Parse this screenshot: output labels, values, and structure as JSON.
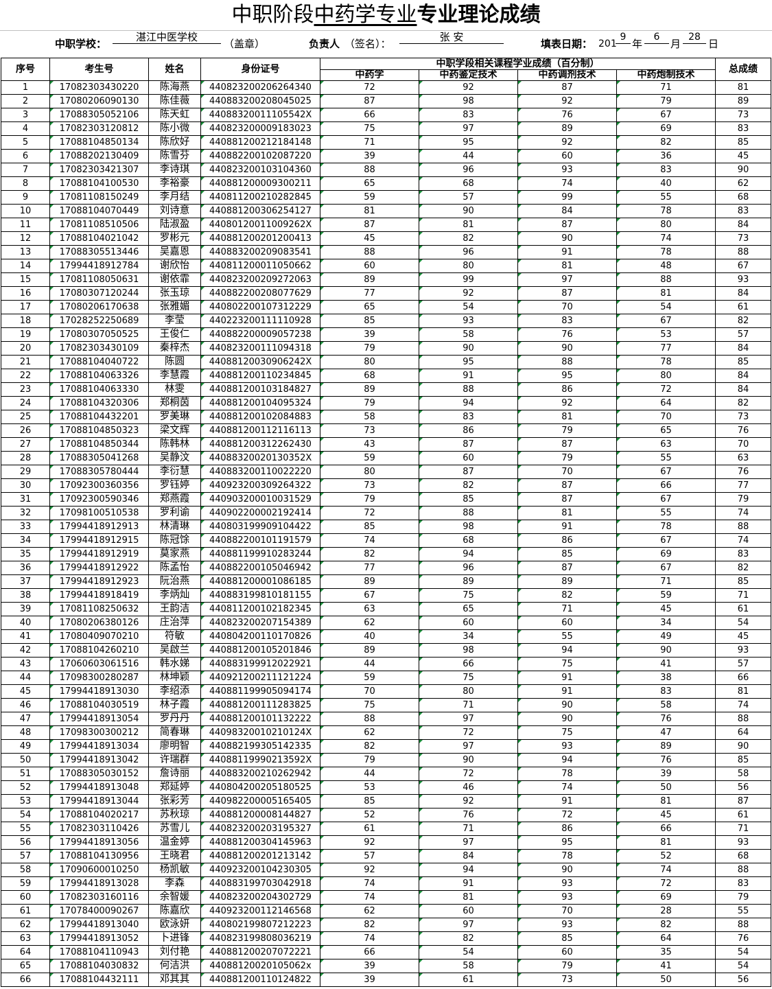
{
  "title": {
    "part1": "中职阶段",
    "part2": "中药学专业",
    "part3": "专业理论成绩"
  },
  "meta": {
    "school_label": "中职学校：",
    "school_value": "湛江中医学校",
    "seal": "（盖章）",
    "person_label": "负责人",
    "person_hint": "（签名）：",
    "person_value": "张  安",
    "date_label": "填表日期：",
    "year_prefix": "201",
    "year_digit": "9",
    "year_unit": "年",
    "month": "6",
    "month_unit": "月",
    "day": "28",
    "day_unit": "日"
  },
  "table": {
    "headers": {
      "seq": "序号",
      "exam_no": "考生号",
      "name": "姓名",
      "id": "身份证号",
      "group": "中职学段相关课程学业成绩（百分制）",
      "c1": "中药学",
      "c2": "中药鉴定技术",
      "c3": "中药调剂技术",
      "c4": "中药炮制技术",
      "total": "总成绩"
    },
    "rows": [
      [
        "1",
        "17082303430220",
        "陈海燕",
        "440823200206264340",
        "72",
        "92",
        "87",
        "71",
        "81"
      ],
      [
        "2",
        "17080206090130",
        "陈佳薇",
        "440883200208045025",
        "87",
        "98",
        "92",
        "79",
        "89"
      ],
      [
        "3",
        "17088305052106",
        "陈天虹",
        "44088320011105542X",
        "66",
        "83",
        "76",
        "67",
        "73"
      ],
      [
        "4",
        "17082303120812",
        "陈小微",
        "440823200009183023",
        "75",
        "97",
        "89",
        "69",
        "83"
      ],
      [
        "5",
        "17088104850134",
        "陈欣好",
        "440881200212184148",
        "71",
        "95",
        "92",
        "82",
        "85"
      ],
      [
        "6",
        "17088202130409",
        "陈雪芬",
        "440882200102087220",
        "39",
        "44",
        "60",
        "36",
        "45"
      ],
      [
        "7",
        "17082303421307",
        "李诗琪",
        "440823200103104360",
        "88",
        "96",
        "93",
        "83",
        "90"
      ],
      [
        "8",
        "17088104100530",
        "李裕豪",
        "440881200009300211",
        "65",
        "68",
        "74",
        "40",
        "62"
      ],
      [
        "9",
        "17081108150249",
        "李月结",
        "440811200210282845",
        "59",
        "57",
        "99",
        "55",
        "68"
      ],
      [
        "10",
        "17088104070449",
        "刘诗意",
        "440881200306254127",
        "81",
        "90",
        "84",
        "78",
        "83"
      ],
      [
        "11",
        "17081108510506",
        "陆淑盈",
        "44080120011009262X",
        "87",
        "81",
        "87",
        "80",
        "84"
      ],
      [
        "12",
        "17088104021042",
        "罗彬元",
        "440881200201200413",
        "45",
        "82",
        "90",
        "74",
        "73"
      ],
      [
        "13",
        "17088305513446",
        "吴嘉恩",
        "440883200209083541",
        "88",
        "96",
        "91",
        "78",
        "88"
      ],
      [
        "14",
        "17994418912784",
        "谢欣怡",
        "440811200011050662",
        "60",
        "80",
        "81",
        "48",
        "67"
      ],
      [
        "15",
        "17081108050631",
        "谢依霏",
        "440823200209272063",
        "89",
        "99",
        "97",
        "88",
        "93"
      ],
      [
        "16",
        "17080307120244",
        "张玉琼",
        "440882200208077629",
        "77",
        "92",
        "87",
        "81",
        "84"
      ],
      [
        "17",
        "17080206170638",
        "张雅媚",
        "440802200107312229",
        "65",
        "54",
        "70",
        "54",
        "61"
      ],
      [
        "18",
        "17028252250689",
        "李莹",
        "440223200111110928",
        "85",
        "93",
        "83",
        "67",
        "82"
      ],
      [
        "19",
        "17080307050525",
        "王俊仁",
        "440882200009057238",
        "39",
        "58",
        "76",
        "53",
        "57"
      ],
      [
        "20",
        "17082303430109",
        "秦梓杰",
        "440823200111094318",
        "79",
        "90",
        "90",
        "77",
        "84"
      ],
      [
        "21",
        "17088104040722",
        "陈圆",
        "44088120030906242X",
        "80",
        "95",
        "88",
        "78",
        "85"
      ],
      [
        "22",
        "17088104063326",
        "李慧霞",
        "440881200110234845",
        "68",
        "91",
        "95",
        "80",
        "84"
      ],
      [
        "23",
        "17088104063330",
        "林雯",
        "440881200103184827",
        "89",
        "88",
        "86",
        "72",
        "84"
      ],
      [
        "24",
        "17088104320306",
        "郑桐茵",
        "440881200104095324",
        "79",
        "94",
        "92",
        "64",
        "82"
      ],
      [
        "25",
        "17088104432201",
        "罗美琳",
        "440881200102084883",
        "58",
        "83",
        "81",
        "70",
        "73"
      ],
      [
        "26",
        "17088104850323",
        "梁文辉",
        "440881200112116113",
        "73",
        "86",
        "79",
        "65",
        "76"
      ],
      [
        "27",
        "17088104850344",
        "陈韩林",
        "440881200312262430",
        "43",
        "87",
        "87",
        "63",
        "70"
      ],
      [
        "28",
        "17088305041268",
        "吴静汶",
        "44088320020130352X",
        "59",
        "60",
        "79",
        "55",
        "63"
      ],
      [
        "29",
        "17088305780444",
        "李衍慧",
        "440883200110022220",
        "80",
        "87",
        "70",
        "67",
        "76"
      ],
      [
        "30",
        "17092300360356",
        "罗钰婷",
        "440923200309264322",
        "73",
        "82",
        "87",
        "66",
        "77"
      ],
      [
        "31",
        "17092300590346",
        "郑燕霞",
        "440903200010031529",
        "79",
        "85",
        "87",
        "67",
        "79"
      ],
      [
        "32",
        "17098100510538",
        "罗利谕",
        "440902200002192414",
        "72",
        "88",
        "81",
        "55",
        "74"
      ],
      [
        "33",
        "17994418912913",
        "林清琳",
        "440803199909104422",
        "85",
        "98",
        "91",
        "78",
        "88"
      ],
      [
        "34",
        "17994418912915",
        "陈冠馀",
        "440882200101191579",
        "74",
        "68",
        "86",
        "67",
        "74"
      ],
      [
        "35",
        "17994418912919",
        "莫家燕",
        "440881199910283244",
        "82",
        "94",
        "85",
        "69",
        "83"
      ],
      [
        "36",
        "17994418912922",
        "陈孟怡",
        "440882200105046942",
        "77",
        "96",
        "87",
        "67",
        "82"
      ],
      [
        "37",
        "17994418912923",
        "阮治燕",
        "440881200001086185",
        "89",
        "89",
        "89",
        "71",
        "85"
      ],
      [
        "38",
        "17994418918419",
        "李炳灿",
        "440883199810181155",
        "67",
        "75",
        "82",
        "59",
        "71"
      ],
      [
        "39",
        "17081108250632",
        "王韵洁",
        "440811200102182345",
        "63",
        "65",
        "71",
        "45",
        "61"
      ],
      [
        "40",
        "17080206380126",
        "庄治萍",
        "440823200207154389",
        "62",
        "60",
        "60",
        "34",
        "54"
      ],
      [
        "41",
        "17080409070210",
        "符敏",
        "440804200110170826",
        "40",
        "34",
        "55",
        "49",
        "45"
      ],
      [
        "42",
        "17088104260210",
        "吴啟兰",
        "440881200105201846",
        "89",
        "98",
        "94",
        "90",
        "93"
      ],
      [
        "43",
        "17060603061516",
        "韩水娣",
        "440883199912022921",
        "44",
        "66",
        "75",
        "41",
        "57"
      ],
      [
        "44",
        "17098300280287",
        "林坤颖",
        "440921200211121224",
        "59",
        "75",
        "91",
        "38",
        "66"
      ],
      [
        "45",
        "17994418913030",
        "李绍添",
        "440881199905094174",
        "70",
        "80",
        "91",
        "83",
        "81"
      ],
      [
        "46",
        "17088104030519",
        "林子霞",
        "440881200111283825",
        "75",
        "71",
        "90",
        "58",
        "74"
      ],
      [
        "47",
        "17994418913054",
        "罗丹丹",
        "440881200101132222",
        "88",
        "97",
        "90",
        "76",
        "88"
      ],
      [
        "48",
        "17098300300212",
        "简春琳",
        "44098320010210124X",
        "62",
        "72",
        "75",
        "47",
        "64"
      ],
      [
        "49",
        "17994418913034",
        "廖明智",
        "440882199305142335",
        "82",
        "97",
        "93",
        "89",
        "90"
      ],
      [
        "50",
        "17994418913042",
        "许瑞群",
        "44088119990213592X",
        "79",
        "90",
        "94",
        "76",
        "85"
      ],
      [
        "51",
        "17088305030152",
        "詹诗丽",
        "440883200210262942",
        "44",
        "72",
        "78",
        "39",
        "58"
      ],
      [
        "52",
        "17994418913048",
        "郑延婷",
        "440804200205180525",
        "53",
        "46",
        "74",
        "50",
        "56"
      ],
      [
        "53",
        "17994418913044",
        "张彩芳",
        "440982200005165405",
        "85",
        "92",
        "91",
        "81",
        "87"
      ],
      [
        "54",
        "17088104020217",
        "苏秋琼",
        "440881200008144827",
        "52",
        "76",
        "72",
        "45",
        "61"
      ],
      [
        "55",
        "17082303110426",
        "苏雪儿",
        "440823200203195327",
        "61",
        "71",
        "86",
        "66",
        "71"
      ],
      [
        "56",
        "17994418913056",
        "温金婷",
        "440881200304145963",
        "92",
        "97",
        "95",
        "81",
        "93"
      ],
      [
        "57",
        "17088104130956",
        "王晓君",
        "440881200201213142",
        "57",
        "84",
        "78",
        "52",
        "68"
      ],
      [
        "58",
        "17090600010250",
        "杨凯敏",
        "440923200104230305",
        "92",
        "94",
        "90",
        "74",
        "88"
      ],
      [
        "59",
        "17994418913028",
        "李森",
        "440883199703042918",
        "74",
        "91",
        "93",
        "72",
        "83"
      ],
      [
        "60",
        "17082303160116",
        "余智媛",
        "440823200204302729",
        "74",
        "81",
        "93",
        "69",
        "79"
      ],
      [
        "61",
        "17078400090267",
        "陈嘉欣",
        "440923200112146568",
        "62",
        "60",
        "70",
        "28",
        "55"
      ],
      [
        "62",
        "17994418913040",
        "欧泳妍",
        "440802199807212223",
        "82",
        "97",
        "93",
        "82",
        "88"
      ],
      [
        "63",
        "17994418913052",
        "卜进锋",
        "440823199808036219",
        "74",
        "82",
        "85",
        "64",
        "76"
      ],
      [
        "64",
        "17088104110943",
        "刘付艳",
        "440881200207072221",
        "66",
        "54",
        "60",
        "35",
        "54"
      ],
      [
        "65",
        "17088104030832",
        "何洁洪",
        "44088120020105062x",
        "39",
        "58",
        "79",
        "41",
        "54"
      ],
      [
        "66",
        "17088104432111",
        "邓其其",
        "440881200110124822",
        "39",
        "61",
        "73",
        "50",
        "56"
      ]
    ]
  }
}
